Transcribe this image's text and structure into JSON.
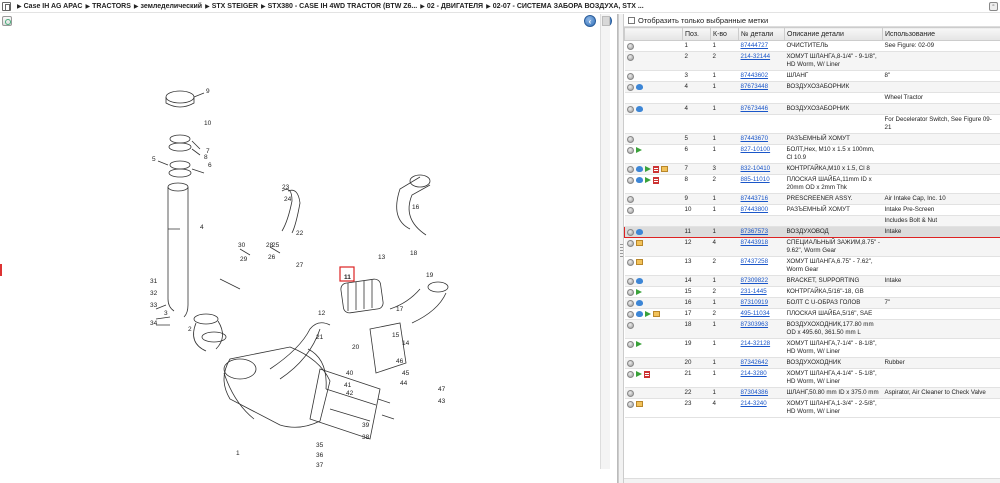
{
  "breadcrumb": [
    "Case IH AG APAC",
    "TRACTORS",
    "земледелический",
    "STX STEIGER",
    "STX380 - CASE IH 4WD TRACTOR (BTW Z6...",
    "02 - ДВИГАТЕЛЯ",
    "02-07 - СИСТЕМА ЗАБОРА ВОЗДУХА, STX ..."
  ],
  "nav": {
    "back": "‹",
    "forward": "›"
  },
  "filter": {
    "label": "Отобразить только выбранные метки"
  },
  "table": {
    "headers": [
      "",
      "Поз.",
      "К-во",
      "№ детали",
      "Описание детали",
      "Использование"
    ],
    "rows": [
      {
        "icons": [
          "info"
        ],
        "pos": "1",
        "qty": "1",
        "part": "87444727",
        "desc": "ОЧИСТИТЕЛЬ",
        "usage": "See Figure: 02-09"
      },
      {
        "icons": [
          "info"
        ],
        "pos": "2",
        "qty": "2",
        "part": "214-32144",
        "desc": "ХОМУТ ШЛАНГА,8-1/4\" - 9-1/8\", HD Worm, W/ Liner",
        "usage": ""
      },
      {
        "icons": [
          "info"
        ],
        "pos": "3",
        "qty": "1",
        "part": "87443602",
        "desc": "ШЛАНГ",
        "usage": "8\""
      },
      {
        "icons": [
          "info",
          "link"
        ],
        "pos": "4",
        "qty": "1",
        "part": "87673448",
        "desc": "ВОЗДУХОЗАБОРНИК",
        "usage": ""
      },
      {
        "icons": [],
        "pos": "",
        "qty": "",
        "part": "",
        "desc": "",
        "usage": "Wheel Tractor"
      },
      {
        "icons": [
          "info",
          "link"
        ],
        "pos": "4",
        "qty": "1",
        "part": "87673446",
        "desc": "ВОЗДУХОЗАБОРНИК",
        "usage": ""
      },
      {
        "icons": [],
        "pos": "",
        "qty": "",
        "part": "",
        "desc": "",
        "usage": "For Decelerator Switch, See Figure 09-21"
      },
      {
        "icons": [
          "info"
        ],
        "pos": "5",
        "qty": "1",
        "part": "87443670",
        "desc": "РАЗЪЕМНЫЙ ХОМУТ",
        "usage": ""
      },
      {
        "icons": [
          "info",
          "arrow"
        ],
        "pos": "6",
        "qty": "1",
        "part": "827-10100",
        "desc": "БОЛТ,Hex, M10 x 1.5 x 100mm, Cl 10.9",
        "usage": ""
      },
      {
        "icons": [
          "info",
          "link",
          "arrow",
          "list",
          "box"
        ],
        "pos": "7",
        "qty": "3",
        "part": "832-10410",
        "desc": "КОНТРГАЙКА,M10 x 1.5, Cl 8",
        "usage": ""
      },
      {
        "icons": [
          "info",
          "link",
          "arrow",
          "list"
        ],
        "pos": "8",
        "qty": "2",
        "part": "885-11010",
        "desc": "ПЛОСКАЯ ШАЙБА,11mm ID x 20mm OD x 2mm Thk",
        "usage": ""
      },
      {
        "icons": [
          "info"
        ],
        "pos": "9",
        "qty": "1",
        "part": "87443716",
        "desc": "PRESCREENER ASSY.",
        "usage": "Air Intake Cap, Inc. 10"
      },
      {
        "icons": [
          "info"
        ],
        "pos": "10",
        "qty": "1",
        "part": "87443800",
        "desc": "РАЗЪЕМНЫЙ ХОМУТ",
        "usage": "Intake Pre-Screen"
      },
      {
        "icons": [],
        "pos": "",
        "qty": "",
        "part": "",
        "desc": "",
        "usage": "Includes Bolt & Nut"
      },
      {
        "icons": [
          "info",
          "link"
        ],
        "pos": "11",
        "qty": "1",
        "part": "87367573",
        "desc": "ВОЗДУХОВОД",
        "usage": "Intake",
        "selected": true
      },
      {
        "icons": [
          "info",
          "box"
        ],
        "pos": "12",
        "qty": "4",
        "part": "87443918",
        "desc": "СПЕЦИАЛЬНЫЙ ЗАЖИМ,8.75\" - 9.62\", Worm Gear",
        "usage": ""
      },
      {
        "icons": [
          "info",
          "box"
        ],
        "pos": "13",
        "qty": "2",
        "part": "87437258",
        "desc": "ХОМУТ ШЛАНГА,6.75\" - 7.62\", Worm Gear",
        "usage": ""
      },
      {
        "icons": [
          "info",
          "link"
        ],
        "pos": "14",
        "qty": "1",
        "part": "87309822",
        "desc": "BRACKET, SUPPORTING",
        "usage": "Intake"
      },
      {
        "icons": [
          "info",
          "arrow"
        ],
        "pos": "15",
        "qty": "2",
        "part": "231-1445",
        "desc": "КОНТРГАЙКА,5/16\"-18, GB",
        "usage": ""
      },
      {
        "icons": [
          "info",
          "link"
        ],
        "pos": "16",
        "qty": "1",
        "part": "87310919",
        "desc": "БОЛТ С U-ОБРАЗ ГОЛОВ",
        "usage": "7\""
      },
      {
        "icons": [
          "info",
          "link",
          "arrow",
          "box"
        ],
        "pos": "17",
        "qty": "2",
        "part": "495-11034",
        "desc": "ПЛОСКАЯ ШАЙБА,5/16\", SAE",
        "usage": ""
      },
      {
        "icons": [
          "info"
        ],
        "pos": "18",
        "qty": "1",
        "part": "87303963",
        "desc": "ВОЗДУХОХОДНИК,177.80 mm OD x 495.60, 361.50 mm L",
        "usage": ""
      },
      {
        "icons": [
          "info",
          "arrow"
        ],
        "pos": "19",
        "qty": "1",
        "part": "214-32128",
        "desc": "ХОМУТ ШЛАНГА,7-1/4\" - 8-1/8\", HD Worm, W/ Liner",
        "usage": ""
      },
      {
        "icons": [
          "info"
        ],
        "pos": "20",
        "qty": "1",
        "part": "87342642",
        "desc": "ВОЗДУХОХОДНИК",
        "usage": "Rubber"
      },
      {
        "icons": [
          "info",
          "arrow",
          "list"
        ],
        "pos": "21",
        "qty": "1",
        "part": "214-3280",
        "desc": "ХОМУТ ШЛАНГА,4-1/4\" - 5-1/8\", HD Worm, W/ Liner",
        "usage": ""
      },
      {
        "icons": [
          "info"
        ],
        "pos": "22",
        "qty": "1",
        "part": "87304386",
        "desc": "ШЛАНГ,50.80 mm ID x 375.0 mm",
        "usage": "Aspirator, Air Cleaner to Check Valve"
      },
      {
        "icons": [
          "info",
          "box"
        ],
        "pos": "23",
        "qty": "4",
        "part": "214-3240",
        "desc": "ХОМУТ ШЛАНГА,1-3/4\" - 2-5/8\", HD Worm, W/ Liner",
        "usage": ""
      }
    ]
  },
  "diagram": {
    "callouts": [
      "1",
      "2",
      "3",
      "4",
      "5",
      "6",
      "7",
      "8",
      "9",
      "10",
      "11",
      "12",
      "13",
      "14",
      "15",
      "16",
      "17",
      "18",
      "19",
      "20",
      "21",
      "22",
      "23",
      "24",
      "25",
      "26",
      "27",
      "28",
      "29",
      "30",
      "31",
      "32",
      "33",
      "34",
      "35",
      "36",
      "37",
      "38",
      "39",
      "40",
      "41",
      "42",
      "43",
      "44",
      "45",
      "46",
      "47"
    ],
    "highlighted": "11"
  }
}
